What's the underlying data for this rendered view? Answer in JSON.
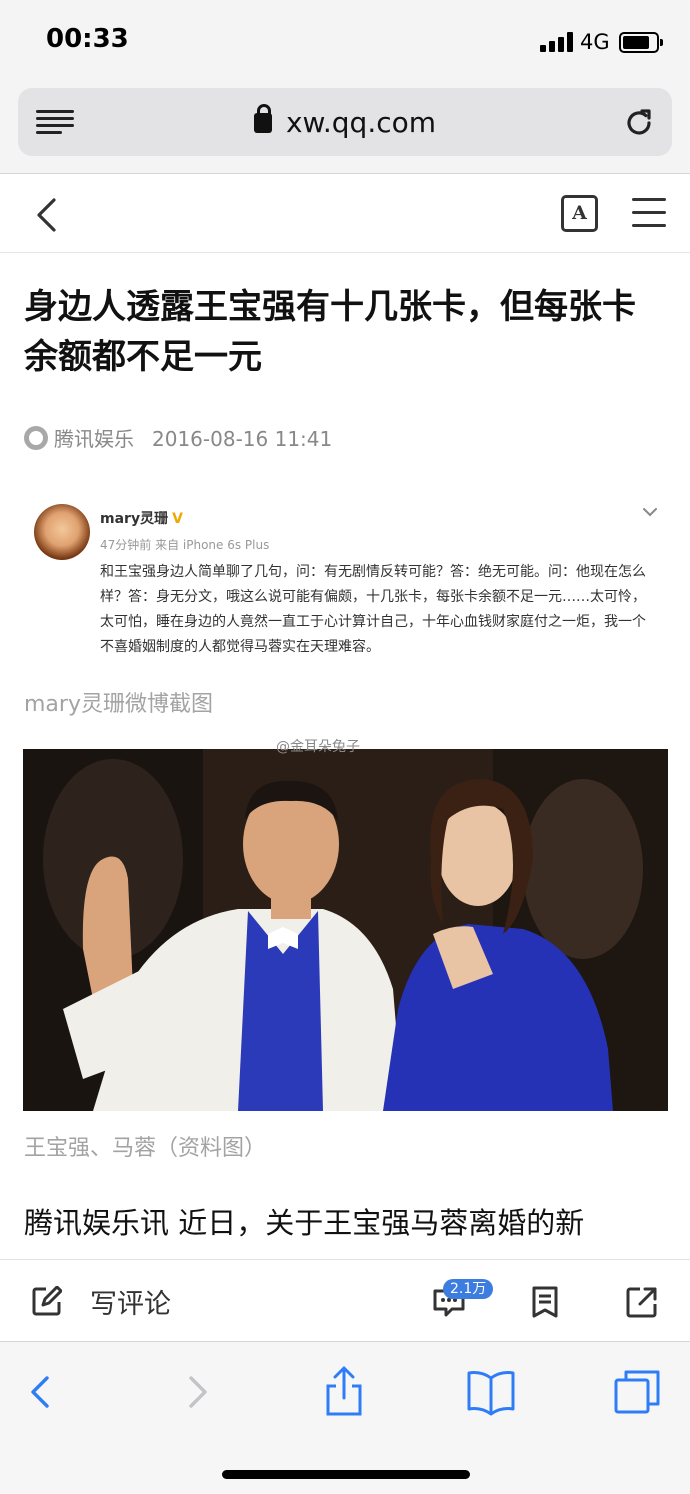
{
  "status_bar": {
    "time": "00:33",
    "network": "4G",
    "battery_level": 0.8
  },
  "browser": {
    "url": "xw.qq.com"
  },
  "toolbar": {
    "font_button": "A"
  },
  "article": {
    "title": "身边人透露王宝强有十几张卡，但每张卡余额都不足一元",
    "source": "腾讯娱乐",
    "date": "2016-08-16 11:41",
    "weibo": {
      "user": "mary灵珊",
      "verified_mark": "V",
      "time": "47分钟前 来自 iPhone 6s Plus",
      "text": "和王宝强身边人简单聊了几句，问：有无剧情反转可能？答：绝无可能。问：他现在怎么样？答：身无分文，哦这么说可能有偏颇，十几张卡，每张卡余额不足一元……太可怜，太可怕，睡在身边的人竟然一直工于心计算计自己，十年心血钱财家庭付之一炬，我一个不喜婚姻制度的人都觉得马蓉实在天理难容。"
    },
    "caption_weibo": "mary灵珊微博截图",
    "watermark": "@金耳朵兔子",
    "caption_photo": "王宝强、马蓉（资料图）",
    "body_first_line": "腾讯娱乐讯 近日，关于王宝强马蓉离婚的新"
  },
  "comment_bar": {
    "write_label": "写评论",
    "comment_count": "2.1万"
  },
  "colors": {
    "accent": "#3d7de0",
    "safari_blue": "#2f7df6",
    "caption_gray": "#a3a3a3"
  }
}
